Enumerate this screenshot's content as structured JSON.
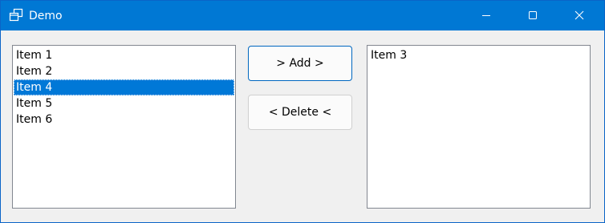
{
  "window": {
    "title": "Demo"
  },
  "left_list": {
    "items": [
      "Item 1",
      "Item 2",
      "Item 4",
      "Item 5",
      "Item 6"
    ],
    "selected_item": "Item 4"
  },
  "buttons": {
    "add_label": "> Add >",
    "delete_label": "< Delete <"
  },
  "right_list": {
    "items": [
      "Item 3"
    ]
  },
  "colors": {
    "titlebar": "#0078d4",
    "selection": "#0078d7"
  },
  "icons": {
    "app": "app-windows-icon",
    "minimize": "minimize-icon",
    "maximize": "maximize-icon",
    "close": "close-icon"
  }
}
